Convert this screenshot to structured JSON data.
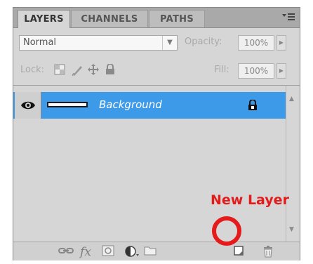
{
  "tabs": [
    {
      "label": "LAYERS",
      "active": true
    },
    {
      "label": "CHANNELS",
      "active": false
    },
    {
      "label": "PATHS",
      "active": false
    }
  ],
  "panel_menu_icon": "panel-menu-icon",
  "blend_mode": {
    "value": "Normal"
  },
  "opacity": {
    "label": "Opacity:",
    "value": "100%"
  },
  "lock": {
    "label": "Lock:",
    "icons": [
      "lock-transparent-icon",
      "lock-image-icon",
      "lock-position-icon",
      "lock-all-icon"
    ]
  },
  "fill": {
    "label": "Fill:",
    "value": "100%"
  },
  "layers": [
    {
      "name": "Background",
      "visible": true,
      "locked": true,
      "selected": true
    }
  ],
  "bottom_icons": [
    "link-layers-icon",
    "fx-icon",
    "mask-icon",
    "adjustment-layer-icon",
    "new-group-icon",
    "new-layer-icon",
    "delete-layer-icon"
  ],
  "bottom_text": {
    "fx": "fx"
  },
  "annotation": {
    "text": "New Layer",
    "color": "#e51b1b"
  },
  "colors": {
    "selection": "#3d9ae8",
    "panel": "#d6d6d6",
    "annotation": "#e51b1b"
  }
}
